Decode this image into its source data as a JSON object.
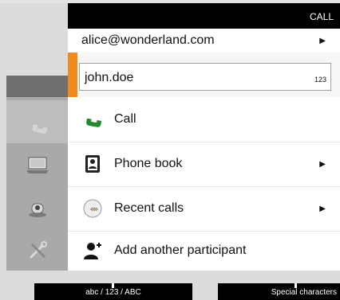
{
  "header": {
    "title": "CALL"
  },
  "address_row": {
    "label": "alice@wonderland.com",
    "has_submenu": true
  },
  "input": {
    "value": "john.doe",
    "mode": "123"
  },
  "menu": [
    {
      "label": "Call",
      "icon": "call-handset-icon",
      "has_submenu": false
    },
    {
      "label": "Phone book",
      "icon": "phone-book-icon",
      "has_submenu": true
    },
    {
      "label": "Recent calls",
      "icon": "recent-calls-icon",
      "has_submenu": true
    },
    {
      "label": "Add another participant",
      "icon": "add-participant-icon",
      "has_submenu": false
    }
  ],
  "rail": [
    {
      "icon": "handset-icon",
      "selected": true
    },
    {
      "icon": "laptop-icon",
      "selected": false
    },
    {
      "icon": "camera-icon",
      "selected": false
    },
    {
      "icon": "tools-icon",
      "selected": false
    }
  ],
  "softkeys": [
    {
      "label": "abc / 123 / ABC"
    },
    {
      "label": "Special characters"
    }
  ],
  "colors": {
    "accent": "#f08a1c",
    "call_green": "#1f8a2a",
    "title_bar": "#000000"
  }
}
